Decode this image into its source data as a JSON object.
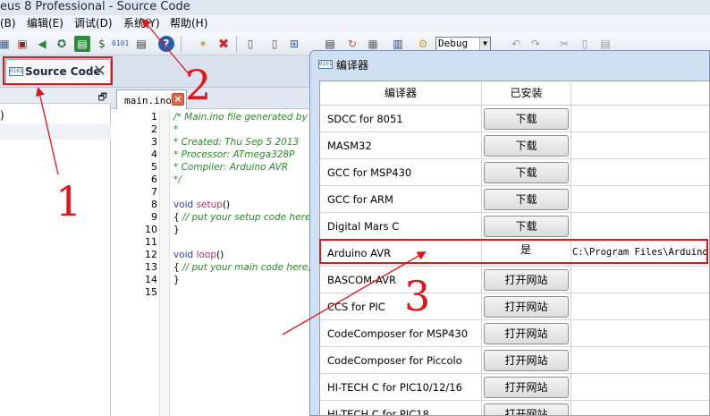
{
  "window": {
    "title": "eus 8 Professional - Source Code"
  },
  "menu": {
    "items": [
      "(B)",
      "编辑(E)",
      "调试(D)",
      "系统(Y)",
      "帮助(H)"
    ]
  },
  "toolbar": {
    "debug_select_value": "Debug",
    "icons": [
      "new-chip-icon",
      "component-icon",
      "step-back-icon",
      "earth-icon",
      "memory-icon",
      "dollar-doc-icon",
      "io-icon",
      "document-icon",
      "help-icon",
      "open-folder-icon",
      "delete-icon",
      "page-icon",
      "copy-doc-icon",
      "zoom-icon",
      "build-icon",
      "refresh-icon",
      "print-icon",
      "chip-icon",
      "gear-icon",
      "undo-icon",
      "redo-icon",
      "cut-icon",
      "copy-icon",
      "paste-icon"
    ]
  },
  "doc_tab": {
    "icon_text": "0101",
    "label": "Source Code"
  },
  "left_panel": {
    "text": ")",
    "pin": "🗗"
  },
  "editor": {
    "file_tab": "main.ino",
    "close_glyph": "×",
    "line_numbers": [
      "1",
      "2",
      "3",
      "4",
      "5",
      "6",
      "7",
      "8",
      "9",
      "10",
      "11",
      "12",
      "13",
      "14",
      "15"
    ],
    "lines": [
      "/* Main.ino file generated by Ne",
      " *",
      " * Created:   Thu Sep 5 2013",
      " * Processor: ATmega328P",
      " * Compiler:  Arduino AVR",
      " */",
      "",
      "void setup()",
      "{ // put your setup code here, to",
      "}",
      "",
      "void loop()",
      "{ // put your main code here, to",
      "}",
      ""
    ],
    "setup_kw": "void",
    "setup_fn": "setup",
    "setup_tail": "()",
    "setup_brace": "{",
    "setup_comment": " // put your setup code here, to",
    "loop_kw": "void",
    "loop_fn": "loop",
    "loop_tail": "()",
    "loop_brace": "{",
    "loop_comment": " // put your main code here, to",
    "close_brace": "}"
  },
  "dialog": {
    "title": "编译器",
    "icon_text": "0101",
    "columns": [
      "编译器",
      "已安装"
    ],
    "rows": [
      {
        "name": "SDCC for 8051",
        "action": "下载"
      },
      {
        "name": "MASM32",
        "action": "下载"
      },
      {
        "name": "GCC for MSP430",
        "action": "下载"
      },
      {
        "name": "GCC for ARM",
        "action": "下载"
      },
      {
        "name": "Digital Mars C",
        "action": "下载"
      },
      {
        "name": "Arduino AVR",
        "installed": "是",
        "path": "C:\\Program Files\\Arduino"
      },
      {
        "name": "BASCOM-AVR",
        "action": "打开网站"
      },
      {
        "name": "CCS for PIC",
        "action": "打开网站"
      },
      {
        "name": "CodeComposer for MSP430",
        "action": "打开网站"
      },
      {
        "name": "CodeComposer for Piccolo",
        "action": "打开网站"
      },
      {
        "name": "HI-TECH C for PIC10/12/16",
        "action": "打开网站"
      },
      {
        "name": "HI-TECH C for PIC18",
        "action": "打开网站"
      }
    ]
  },
  "annotations": {
    "labels": [
      "1",
      "2",
      "3"
    ],
    "color": "#e0161a"
  }
}
